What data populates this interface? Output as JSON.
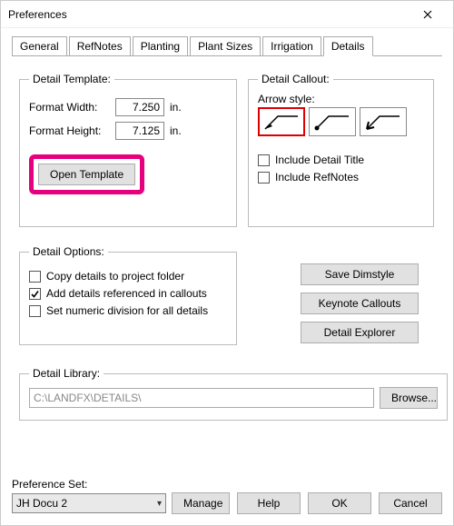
{
  "window": {
    "title": "Preferences"
  },
  "tabs": [
    "General",
    "RefNotes",
    "Planting",
    "Plant Sizes",
    "Irrigation",
    "Details"
  ],
  "active_tab": 5,
  "template": {
    "legend": "Detail Template:",
    "width_label": "Format Width:",
    "width_value": "7.250",
    "height_label": "Format Height:",
    "height_value": "7.125",
    "unit": "in.",
    "open_btn": "Open Template"
  },
  "callout": {
    "legend": "Detail Callout:",
    "arrow_label": "Arrow style:",
    "include_title": {
      "label": "Include Detail Title",
      "checked": false
    },
    "include_refnotes": {
      "label": "Include RefNotes",
      "checked": false
    }
  },
  "options": {
    "legend": "Detail Options:",
    "copy": {
      "label": "Copy details to project folder",
      "checked": false
    },
    "addref": {
      "label": "Add details referenced in callouts",
      "checked": true
    },
    "numeric": {
      "label": "Set numeric division for all details",
      "checked": false
    }
  },
  "buttons": {
    "save_dimstyle": "Save Dimstyle",
    "keynote_callouts": "Keynote Callouts",
    "detail_explorer": "Detail Explorer"
  },
  "library": {
    "legend": "Detail Library:",
    "path": "C:\\LANDFX\\DETAILS\\",
    "browse": "Browse..."
  },
  "prefset": {
    "label": "Preference Set:",
    "value": "JH Docu 2",
    "manage": "Manage"
  },
  "footer": {
    "help": "Help",
    "ok": "OK",
    "cancel": "Cancel"
  }
}
